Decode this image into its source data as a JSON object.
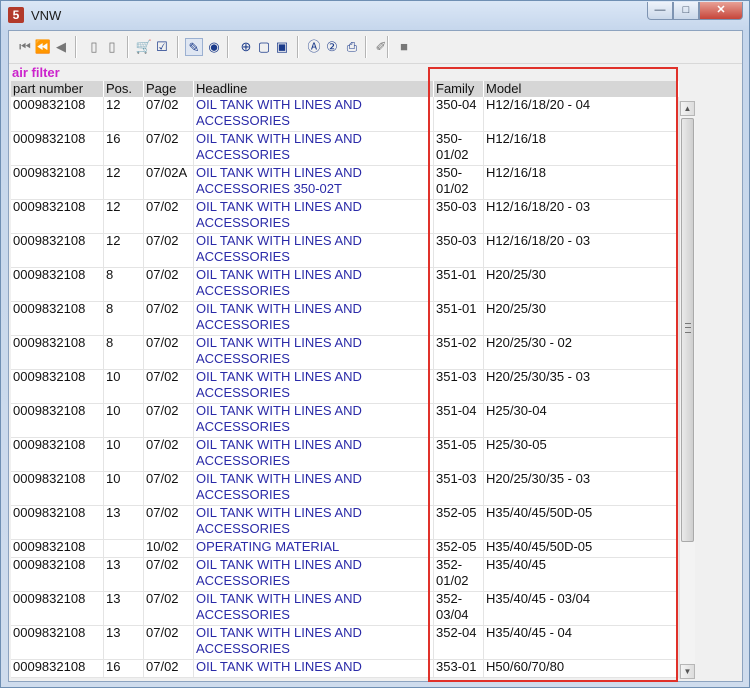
{
  "window": {
    "title": "VNW",
    "app_icon": "5",
    "minimize": "—",
    "maximize": "□",
    "close": "✕"
  },
  "toolbar": [
    {
      "name": "first-record-icon",
      "glyph": "⏮"
    },
    {
      "name": "fast-back-icon",
      "glyph": "⏪"
    },
    {
      "name": "previous-icon",
      "glyph": "◀"
    },
    {
      "name": "page-back-icon",
      "glyph": "▯"
    },
    {
      "name": "page-forward-icon",
      "glyph": "▯"
    },
    {
      "name": "cart-icon",
      "glyph": "🛒"
    },
    {
      "name": "checklist-icon",
      "glyph": "☑"
    },
    {
      "name": "filter-icon",
      "glyph": "✎"
    },
    {
      "name": "globe-icon",
      "glyph": "◉"
    },
    {
      "name": "zoom-icon",
      "glyph": "⊕"
    },
    {
      "name": "page-icon",
      "glyph": "▢"
    },
    {
      "name": "page-copy-icon",
      "glyph": "▣"
    },
    {
      "name": "a-circle-icon",
      "glyph": "Ⓐ"
    },
    {
      "name": "two-circle-icon",
      "glyph": "②"
    },
    {
      "name": "print-icon",
      "glyph": "⎙"
    },
    {
      "name": "edit-disabled-icon",
      "glyph": "✐"
    },
    {
      "name": "stop-icon",
      "glyph": "■"
    }
  ],
  "section_title": "air filter",
  "columns": [
    "part number",
    "Pos.",
    "Page",
    "Headline",
    "Family",
    "Model"
  ],
  "rows": [
    {
      "part": "0009832108",
      "pos": "12",
      "page": "07/02",
      "headline": [
        "OIL TANK WITH LINES AND",
        "ACCESSORIES"
      ],
      "family": [
        "350-04"
      ],
      "model": "H12/16/18/20 - 04"
    },
    {
      "part": "0009832108",
      "pos": "16",
      "page": "07/02",
      "headline": [
        "OIL TANK WITH LINES AND",
        "ACCESSORIES"
      ],
      "family": [
        "350-",
        "01/02"
      ],
      "model": "H12/16/18"
    },
    {
      "part": "0009832108",
      "pos": "12",
      "page": "07/02A",
      "headline": [
        "OIL TANK WITH LINES AND",
        "ACCESSORIES 350-02T"
      ],
      "family": [
        "350-",
        "01/02"
      ],
      "model": "H12/16/18"
    },
    {
      "part": "0009832108",
      "pos": "12",
      "page": "07/02",
      "headline": [
        "OIL TANK WITH LINES AND",
        "ACCESSORIES"
      ],
      "family": [
        "350-03"
      ],
      "model": "H12/16/18/20 - 03"
    },
    {
      "part": "0009832108",
      "pos": "12",
      "page": "07/02",
      "headline": [
        "OIL TANK WITH LINES AND",
        "ACCESSORIES"
      ],
      "family": [
        "350-03"
      ],
      "model": "H12/16/18/20 - 03"
    },
    {
      "part": "0009832108",
      "pos": "8",
      "page": "07/02",
      "headline": [
        "OIL TANK WITH LINES AND",
        "ACCESSORIES"
      ],
      "family": [
        "351-01"
      ],
      "model": "H20/25/30"
    },
    {
      "part": "0009832108",
      "pos": "8",
      "page": "07/02",
      "headline": [
        "OIL TANK WITH LINES AND",
        "ACCESSORIES"
      ],
      "family": [
        "351-01"
      ],
      "model": "H20/25/30"
    },
    {
      "part": "0009832108",
      "pos": "8",
      "page": "07/02",
      "headline": [
        "OIL TANK WITH LINES AND",
        "ACCESSORIES"
      ],
      "family": [
        "351-02"
      ],
      "model": "H20/25/30 - 02"
    },
    {
      "part": "0009832108",
      "pos": "10",
      "page": "07/02",
      "headline": [
        "OIL TANK WITH LINES AND",
        "ACCESSORIES"
      ],
      "family": [
        "351-03"
      ],
      "model": "H20/25/30/35 - 03"
    },
    {
      "part": "0009832108",
      "pos": "10",
      "page": "07/02",
      "headline": [
        "OIL TANK WITH LINES AND",
        "ACCESSORIES"
      ],
      "family": [
        "351-04"
      ],
      "model": "H25/30-04"
    },
    {
      "part": "0009832108",
      "pos": "10",
      "page": "07/02",
      "headline": [
        "OIL TANK WITH LINES AND",
        "ACCESSORIES"
      ],
      "family": [
        "351-05"
      ],
      "model": "H25/30-05"
    },
    {
      "part": "0009832108",
      "pos": "10",
      "page": "07/02",
      "headline": [
        "OIL TANK WITH LINES AND",
        "ACCESSORIES"
      ],
      "family": [
        "351-03"
      ],
      "model": "H20/25/30/35 - 03"
    },
    {
      "part": "0009832108",
      "pos": "13",
      "page": "07/02",
      "headline": [
        "OIL TANK WITH LINES AND",
        "ACCESSORIES"
      ],
      "family": [
        "352-05"
      ],
      "model": "H35/40/45/50D-05"
    },
    {
      "part": "0009832108",
      "pos": "",
      "page": "10/02",
      "headline": [
        "OPERATING MATERIAL"
      ],
      "family": [
        "352-05"
      ],
      "model": "H35/40/45/50D-05"
    },
    {
      "part": "0009832108",
      "pos": "13",
      "page": "07/02",
      "headline": [
        "OIL TANK WITH LINES AND",
        "ACCESSORIES"
      ],
      "family": [
        "352-",
        "01/02"
      ],
      "model": "H35/40/45"
    },
    {
      "part": "0009832108",
      "pos": "13",
      "page": "07/02",
      "headline": [
        "OIL TANK WITH LINES AND",
        "ACCESSORIES"
      ],
      "family": [
        "352-",
        "03/04"
      ],
      "model": "H35/40/45 - 03/04"
    },
    {
      "part": "0009832108",
      "pos": "13",
      "page": "07/02",
      "headline": [
        "OIL TANK WITH LINES AND",
        "ACCESSORIES"
      ],
      "family": [
        "352-04"
      ],
      "model": "H35/40/45 - 04"
    },
    {
      "part": "0009832108",
      "pos": "16",
      "page": "07/02",
      "headline": [
        "OIL TANK WITH LINES AND"
      ],
      "family": [
        "353-01"
      ],
      "model": "H50/60/70/80"
    }
  ],
  "scrollbar": {
    "up_arrow": "▲",
    "down_arrow": "▼"
  },
  "colors": {
    "section_title": "#cc22cc",
    "headline_link": "#2a2aa8",
    "highlight_box": "#e0312a"
  }
}
